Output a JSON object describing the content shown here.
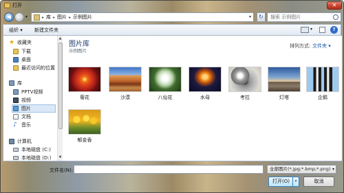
{
  "window": {
    "title": "打开",
    "close_glyph": "✕"
  },
  "address_bar": {
    "breadcrumbs": [
      "库",
      "图片",
      "示例图片"
    ],
    "separator": "▸",
    "search_placeholder": "搜索 示例图片"
  },
  "toolbar": {
    "organize_label": "组织 ▾",
    "new_folder_label": "新建文件夹",
    "help_label": "?"
  },
  "sidebar": {
    "favorites_label": "收藏夹",
    "favorites": [
      "下载",
      "桌面",
      "最近访问的位置"
    ],
    "library_label": "库",
    "libraries": [
      "PPTV视频",
      "视频",
      "图片",
      "文档",
      "音乐"
    ],
    "selected": "图片",
    "computer_label": "计算机",
    "drives": [
      "本地磁盘 (C:)",
      "本地磁盘 (D:)"
    ]
  },
  "main": {
    "library_title": "图片库",
    "library_subtitle": "示例图片",
    "arrange_label": "排列方式:",
    "arrange_value": "文件夹 ▾",
    "items": [
      {
        "label": "菊花"
      },
      {
        "label": "沙漠"
      },
      {
        "label": "八仙花"
      },
      {
        "label": "水母"
      },
      {
        "label": "考拉"
      },
      {
        "label": "灯塔"
      },
      {
        "label": "企鹅"
      },
      {
        "label": "郁金香"
      }
    ]
  },
  "footer": {
    "filename_label": "文件名(N):",
    "filename_value": "",
    "filter_value": "全部图片(*.jpg;*.bmp;*.png)",
    "open_label": "打开(O)",
    "cancel_label": "取消"
  }
}
